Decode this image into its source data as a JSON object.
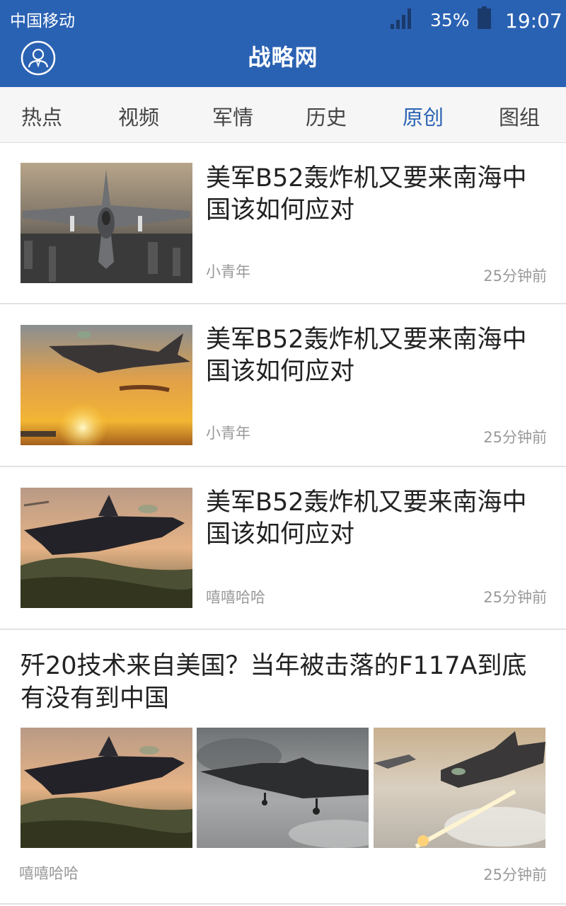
{
  "status_bar": {
    "carrier": "中国移动",
    "battery": "35%",
    "time": "19:07"
  },
  "header": {
    "logo": "战略网",
    "icons": [
      "avatar-icon"
    ]
  },
  "tabs": [
    {
      "label": "热点",
      "active": false
    },
    {
      "label": "视频",
      "active": false
    },
    {
      "label": "军情",
      "active": false
    },
    {
      "label": "历史",
      "active": false
    },
    {
      "label": "原创",
      "active": true
    },
    {
      "label": "图组",
      "active": false
    }
  ],
  "articles": [
    {
      "title": "美军B52轰炸机又要来南海中国该如何应对",
      "author": "小青年",
      "time": "25分钟前"
    },
    {
      "title": "美军B52轰炸机又要来南海中国该如何应对",
      "author": "小青年",
      "time": "25分钟前"
    },
    {
      "title": "美军B52轰炸机又要来南海中国该如何应对",
      "author": "嘻嘻哈哈",
      "time": "25分钟前"
    }
  ],
  "gallery_article": {
    "title": "歼20技术来自美国？当年被击落的F117A到底有没有到中国",
    "author": "嘻嘻哈哈",
    "time": "25分钟前"
  },
  "colors": {
    "accent": "#2a62b3",
    "tab_bg": "#f6f6f6",
    "meta_text": "#999999"
  }
}
